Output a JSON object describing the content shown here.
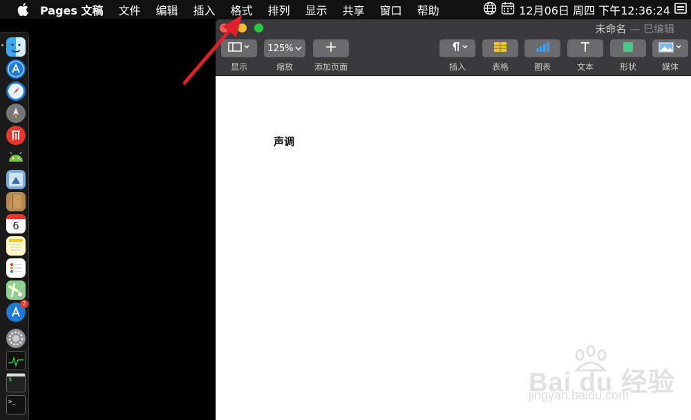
{
  "menubar": {
    "app_name": "Pages 文稿",
    "items": [
      "文件",
      "编辑",
      "插入",
      "格式",
      "排列",
      "显示",
      "共享",
      "窗口",
      "帮助"
    ],
    "clock": "12月06日 周四 下午12:36:24",
    "icons": [
      "apple-icon",
      "globe-icon",
      "calendar-icon",
      "sidebar-toggle-icon"
    ]
  },
  "window": {
    "title": "未命名",
    "title_sep": " — ",
    "status": "已编辑",
    "toolbar": {
      "view_label": "显示",
      "zoom_value": "125%",
      "zoom_label": "缩放",
      "add_page_label": "添加页面",
      "insert_label": "插入",
      "table_label": "表格",
      "chart_label": "图表",
      "text_label": "文本",
      "shape_label": "形状",
      "media_label": "媒体"
    },
    "document_text": "声调"
  },
  "dock": {
    "calendar_day": "6",
    "appstore_badge": "2",
    "terminal_prompt": ">_",
    "terminal_prompt2": "$"
  },
  "watermark": {
    "word": "Bai du 经验",
    "url": "jingyan.baidu.com"
  },
  "colors": {
    "toolbar_bg": "#3a3a3c",
    "button_bg": "#6b6b6e",
    "close": "#fe5f57",
    "minimize": "#febc2e",
    "zoom": "#28c840",
    "arrow": "#e0202a"
  }
}
